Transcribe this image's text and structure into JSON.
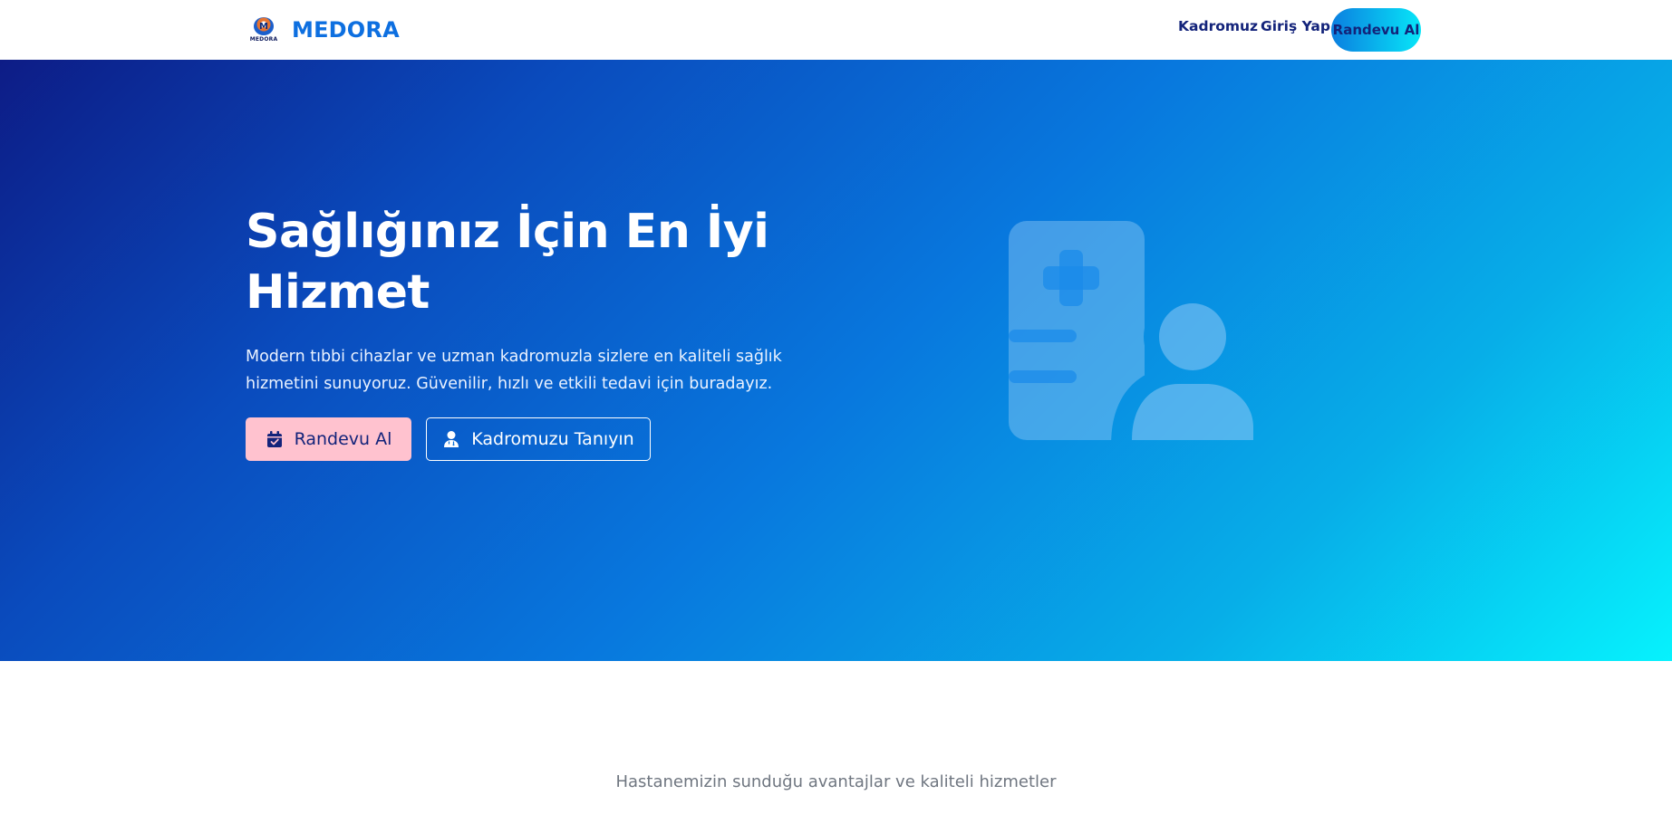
{
  "navbar": {
    "logo_text": "MEDORA",
    "brand_name": "MEDORA",
    "links": [
      {
        "label": "Kadromuz"
      },
      {
        "label": "Giriş Yap"
      }
    ],
    "cta_label": "Randevu Al"
  },
  "hero": {
    "title": "Sağlığınız İçin En İyi Hizmet",
    "description": "Modern tıbbi cihazlar ve uzman kadromuzla sizlere en kaliteli sağlık hizmetini sunuyoruz. Güvenilir, hızlı ve etkili tedavi için buradayız.",
    "primary_button": {
      "label": "Randevu Al",
      "icon": "calendar-check-icon"
    },
    "secondary_button": {
      "label": "Kadromuzu Tanıyın",
      "icon": "user-doctor-icon"
    },
    "illustration_icon": "medical-staff-icon"
  },
  "features": {
    "subtitle": "Hastanemizin sunduğu avantajlar ve kaliteli hizmetler"
  },
  "colors": {
    "brand": "#0d6fe0",
    "nav_text": "#13237a",
    "primary_button_bg": "#ffc2cf",
    "hero_gradient_start": "#0d1c86",
    "hero_gradient_end": "#06f2fd"
  }
}
